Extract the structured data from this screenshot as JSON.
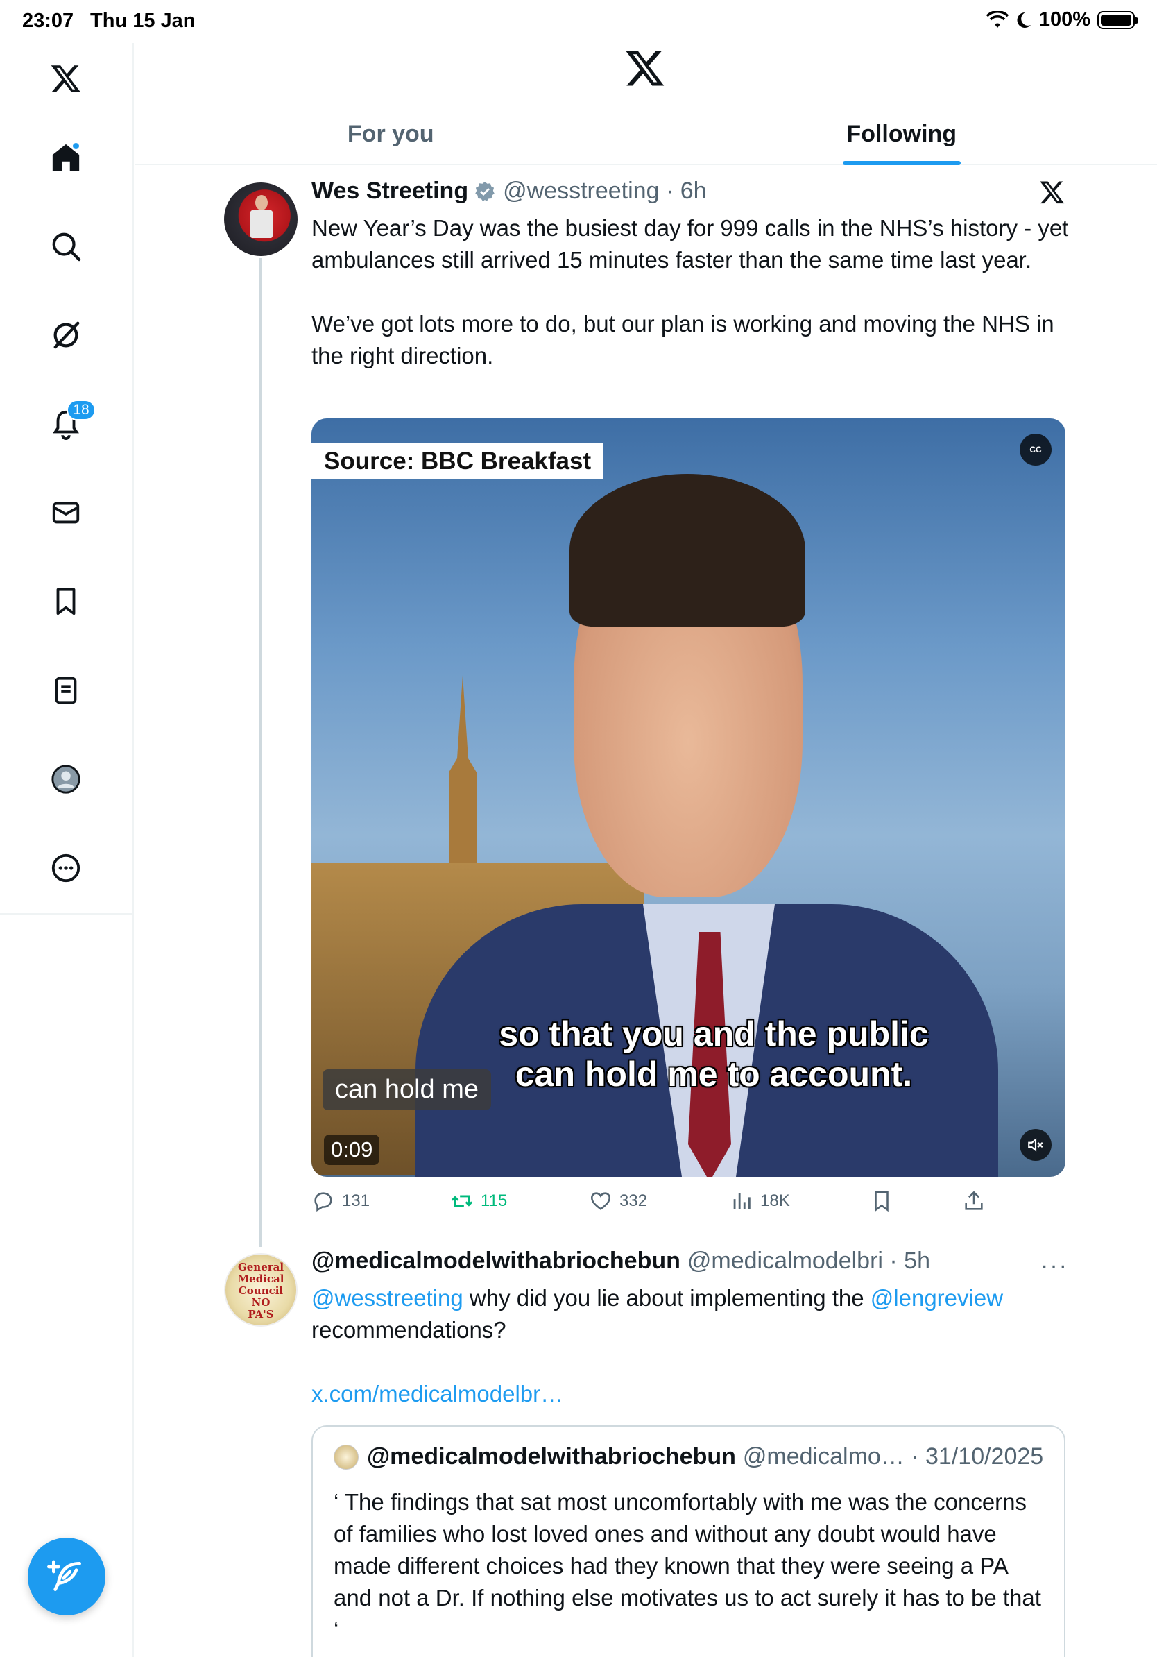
{
  "status_bar": {
    "time": "23:07",
    "date": "Thu 15 Jan",
    "battery": "100%"
  },
  "sidebar": {
    "items": [
      {
        "name": "home",
        "badge": ""
      },
      {
        "name": "explore",
        "badge": ""
      },
      {
        "name": "grok",
        "badge": ""
      },
      {
        "name": "notifications",
        "badge": "18"
      },
      {
        "name": "messages",
        "badge": ""
      },
      {
        "name": "bookmarks",
        "badge": ""
      },
      {
        "name": "lists",
        "badge": ""
      },
      {
        "name": "profile",
        "badge": ""
      },
      {
        "name": "more",
        "badge": ""
      }
    ],
    "compose_icon": "feather-plus-icon"
  },
  "tabs": {
    "for_you": "For you",
    "following": "Following",
    "active": "Following"
  },
  "tweet": {
    "author_name": "Wes Streeting",
    "handle_time": "@wesstreeting · 6h",
    "text": "New Year’s Day was the busiest day for 999 calls in the NHS’s history - yet ambulances still arrived 15 minutes faster than the same time last year.\n\nWe’ve got lots more to do, but our plan is working and moving the NHS in the right direction.",
    "media": {
      "source_label": "Source: BBC Breakfast",
      "cc_label": "CC",
      "burned_caption_line1": "so that you and the public",
      "burned_caption_line2": "can hold me to account.",
      "live_subtitle": "can hold me",
      "duration": "0:09"
    },
    "stats": {
      "replies": "131",
      "reposts": "115",
      "likes": "332",
      "views": "18K"
    }
  },
  "reply": {
    "author_name": "@medicalmodelwithabriochebun",
    "handle_time": "@medicalmodelbri · 5h",
    "more": "···",
    "avatar_text": [
      "General",
      "Medical",
      "Council",
      "NO",
      "PA'S"
    ],
    "mention1": "@wesstreeting",
    "text_mid": " why did you lie about implementing the ",
    "mention2": "@lengreview",
    "text_end": "recommendations?",
    "link": "x.com/medicalmodelbr…",
    "quote": {
      "author_name": "@medicalmodelwithabriochebun",
      "handle_time": "@medicalmo… · 31/10/2025",
      "text": "‘ The findings that sat most uncomfortably with me was the concerns of families who lost loved ones and without any doubt would have made different choices had they known that they were seeing a PA and not a Dr. If nothing else motivates us to act surely it has to be that ‘"
    }
  },
  "colors": {
    "accent": "#1d9bf0",
    "repost_green": "#00ba7c",
    "secondary_text": "#536471"
  }
}
